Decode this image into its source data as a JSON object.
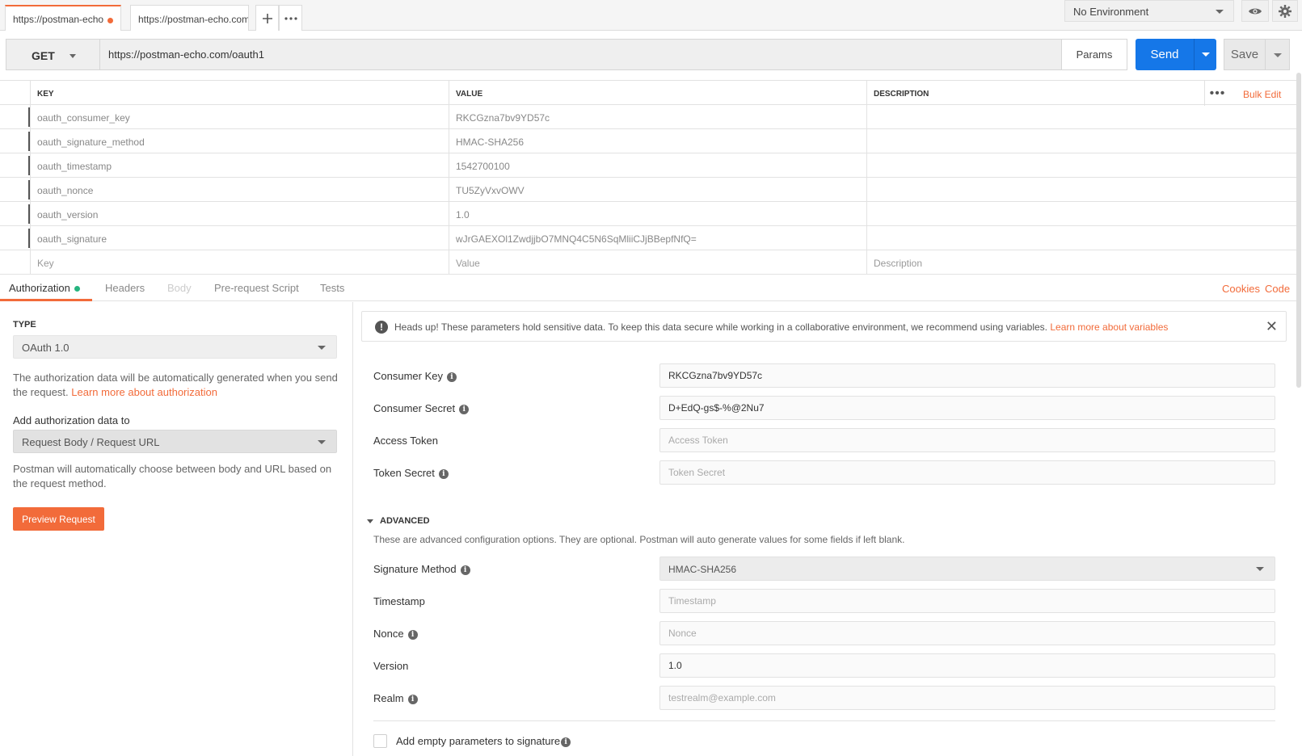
{
  "tabs": [
    {
      "label": "https://postman-echo",
      "active": true,
      "unsaved": true
    },
    {
      "label": "https://postman-echo.com/",
      "active": false,
      "unsaved": false
    }
  ],
  "tab_actions": {
    "add_icon": "plus-icon",
    "more_icon": "ellipsis-icon"
  },
  "environment": {
    "selected": "No Environment"
  },
  "header_icons": [
    "eye-icon",
    "gear-icon"
  ],
  "request": {
    "method": "GET",
    "url": "https://postman-echo.com/oauth1",
    "params_label": "Params",
    "send_label": "Send",
    "save_label": "Save"
  },
  "params_table": {
    "headers": {
      "key": "KEY",
      "value": "VALUE",
      "description": "DESCRIPTION"
    },
    "bulk_edit_label": "Bulk Edit",
    "rows": [
      {
        "key": "oauth_consumer_key",
        "value": "RKCGzna7bv9YD57c",
        "description": ""
      },
      {
        "key": "oauth_signature_method",
        "value": "HMAC-SHA256",
        "description": ""
      },
      {
        "key": "oauth_timestamp",
        "value": "1542700100",
        "description": ""
      },
      {
        "key": "oauth_nonce",
        "value": "TU5ZyVxvOWV",
        "description": ""
      },
      {
        "key": "oauth_version",
        "value": "1.0",
        "description": ""
      },
      {
        "key": "oauth_signature",
        "value": "wJrGAEXOl1ZwdjjbO7MNQ4C5N6SqMliiCJjBBepfNfQ=",
        "description": ""
      }
    ],
    "placeholder": {
      "key": "Key",
      "value": "Value",
      "description": "Description"
    }
  },
  "subtabs": {
    "items": [
      "Authorization",
      "Headers",
      "Body",
      "Pre-request Script",
      "Tests"
    ],
    "active": "Authorization",
    "disabled": "Body",
    "cookies_label": "Cookies",
    "code_label": "Code"
  },
  "auth_left": {
    "type_label": "TYPE",
    "type_value": "OAuth 1.0",
    "help_text": "The authorization data will be automatically generated when you send the request.",
    "help_link": "Learn more about authorization",
    "add_to_label": "Add authorization data to",
    "add_to_value": "Request Body / Request URL",
    "add_to_help": "Postman will automatically choose between body and URL based on the request method.",
    "preview_label": "Preview Request"
  },
  "banner": {
    "text": "Heads up! These parameters hold sensitive data. To keep this data secure while working in a collaborative environment, we recommend using variables.",
    "link": "Learn more about variables"
  },
  "fields": {
    "consumer_key": {
      "label": "Consumer Key",
      "value": "RKCGzna7bv9YD57c",
      "placeholder": "Consumer Key"
    },
    "consumer_secret": {
      "label": "Consumer Secret",
      "value": "D+EdQ-gs$-%@2Nu7",
      "placeholder": "Consumer Secret"
    },
    "access_token": {
      "label": "Access Token",
      "value": "",
      "placeholder": "Access Token"
    },
    "token_secret": {
      "label": "Token Secret",
      "value": "",
      "placeholder": "Token Secret"
    }
  },
  "advanced": {
    "heading": "ADVANCED",
    "description": "These are advanced configuration options. They are optional. Postman will auto generate values for some fields if left blank.",
    "signature_method": {
      "label": "Signature Method",
      "value": "HMAC-SHA256"
    },
    "timestamp": {
      "label": "Timestamp",
      "value": "",
      "placeholder": "Timestamp"
    },
    "nonce": {
      "label": "Nonce",
      "value": "",
      "placeholder": "Nonce"
    },
    "version": {
      "label": "Version",
      "value": "1.0",
      "placeholder": "Version"
    },
    "realm": {
      "label": "Realm",
      "value": "",
      "placeholder": "testrealm@example.com"
    },
    "empty_params_label": "Add empty parameters to signature"
  },
  "colors": {
    "accent": "#f26b3a",
    "send": "#1577e8",
    "status_ok": "#26b47f"
  }
}
